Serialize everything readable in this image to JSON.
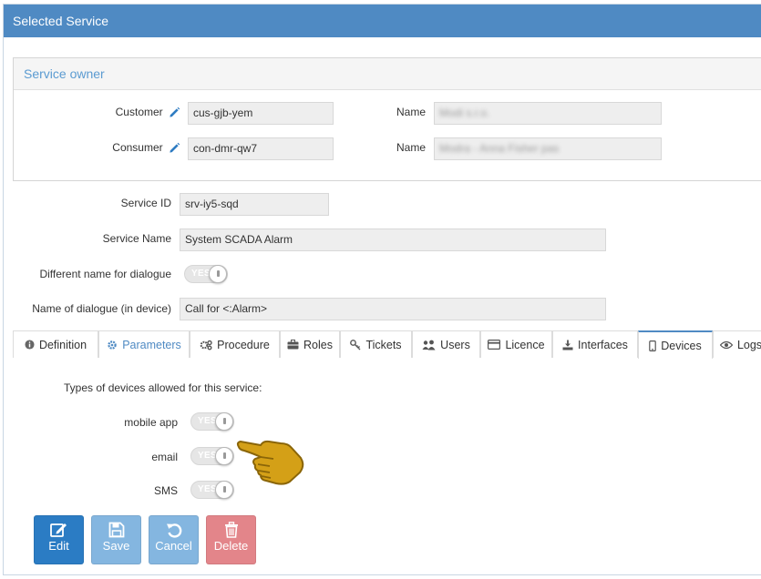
{
  "header": {
    "title": "Selected Service"
  },
  "owner": {
    "title": "Service owner",
    "customer_label": "Customer",
    "customer_value": "cus-gjb-yem",
    "customer_name_label": "Name",
    "customer_name_value": "Modi s.r.o.",
    "consumer_label": "Consumer",
    "consumer_value": "con-dmr-qw7",
    "consumer_name_label": "Name",
    "consumer_name_value": "Modra - Anna Fisher pas"
  },
  "service": {
    "id_label": "Service ID",
    "id_value": "srv-iy5-sqd",
    "name_label": "Service Name",
    "name_value": "System SCADA Alarm",
    "diff_label": "Different name for dialogue",
    "diff_toggle": "YES",
    "dialogue_label": "Name of dialogue (in device)",
    "dialogue_value": "Call for <:Alarm>"
  },
  "tabs": [
    {
      "label": "Definition",
      "icon": "info-icon"
    },
    {
      "label": "Parameters",
      "icon": "gear-icon"
    },
    {
      "label": "Procedure",
      "icon": "cogs-icon"
    },
    {
      "label": "Roles",
      "icon": "briefcase-icon"
    },
    {
      "label": "Tickets",
      "icon": "key-icon"
    },
    {
      "label": "Users",
      "icon": "users-icon"
    },
    {
      "label": "Licence",
      "icon": "card-icon"
    },
    {
      "label": "Interfaces",
      "icon": "download-icon"
    },
    {
      "label": "Devices",
      "icon": "mobile-icon"
    },
    {
      "label": "Logs",
      "icon": "eye-icon"
    }
  ],
  "active_tab": "Devices",
  "devices": {
    "heading": "Types of devices allowed for this service:",
    "items": [
      {
        "label": "mobile app",
        "toggle": "YES"
      },
      {
        "label": "email",
        "toggle": "YES"
      },
      {
        "label": "SMS",
        "toggle": "YES"
      }
    ]
  },
  "buttons": {
    "edit": "Edit",
    "save": "Save",
    "cancel": "Cancel",
    "delete": "Delete"
  },
  "colors": {
    "header": "#4f8ac3",
    "edit": "#2b7cc4",
    "save": "#84b6e0",
    "cancel": "#84b6e0",
    "delete": "#e3858a",
    "owner_title": "#5b9bd1"
  }
}
